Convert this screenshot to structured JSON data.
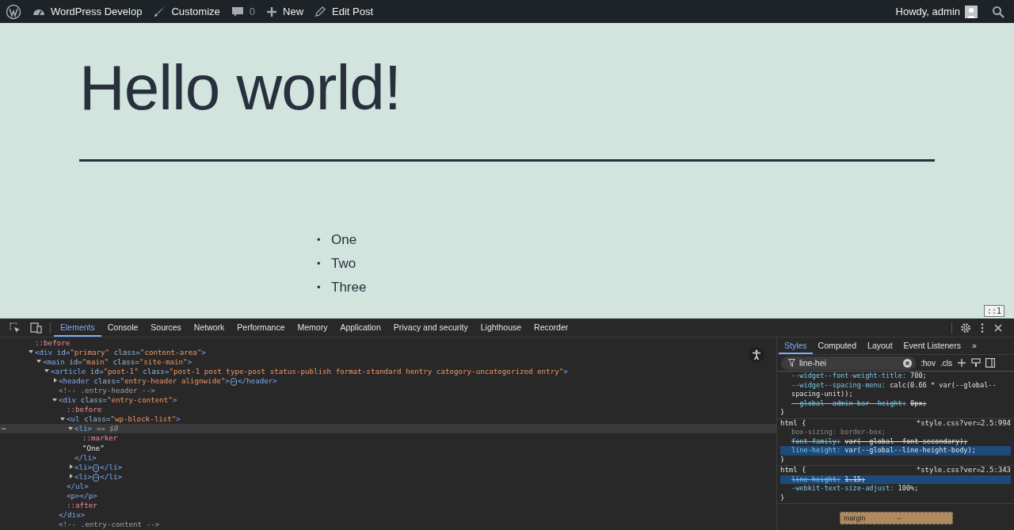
{
  "admin_bar": {
    "items": [
      {
        "kind": "logo"
      },
      {
        "kind": "site",
        "label": "WordPress Develop"
      },
      {
        "kind": "brush",
        "label": "Customize"
      },
      {
        "kind": "comment",
        "label": "0"
      },
      {
        "kind": "plus",
        "label": "New"
      },
      {
        "kind": "pencil",
        "label": "Edit Post"
      }
    ],
    "greeting": "Howdy, admin"
  },
  "page": {
    "title": "Hello world!",
    "list": [
      {
        "bullet": "•",
        "text": "One"
      },
      {
        "bullet": "•",
        "text": "Two"
      },
      {
        "bullet": "•",
        "text": "Three"
      }
    ],
    "badge": "::1"
  },
  "devtools": {
    "tabs": [
      {
        "label": "Elements",
        "selected": true
      },
      {
        "label": "Console",
        "selected": false
      },
      {
        "label": "Sources",
        "selected": false
      },
      {
        "label": "Network",
        "selected": false
      },
      {
        "label": "Performance",
        "selected": false
      },
      {
        "label": "Memory",
        "selected": false
      },
      {
        "label": "Application",
        "selected": false
      },
      {
        "label": "Privacy and security",
        "selected": false
      },
      {
        "label": "Lighthouse",
        "selected": false
      },
      {
        "label": "Recorder",
        "selected": false
      }
    ],
    "tree": [
      {
        "parts": [
          {
            "kind": "pseudo",
            "text": "::before"
          }
        ]
      },
      {
        "expanded": true,
        "parts": [
          {
            "kind": "tag",
            "text": "<div"
          },
          {
            "kind": "attr",
            "text": " id"
          },
          {
            "kind": "tag",
            "text": "="
          },
          {
            "kind": "value",
            "text": "\"primary\""
          },
          {
            "kind": "attr",
            "text": " class"
          },
          {
            "kind": "tag",
            "text": "="
          },
          {
            "kind": "value",
            "text": "\"content-area\""
          },
          {
            "kind": "tag",
            "text": ">"
          }
        ],
        "children": [
          {
            "expanded": true,
            "parts": [
              {
                "kind": "tag",
                "text": "<main"
              },
              {
                "kind": "attr",
                "text": " id"
              },
              {
                "kind": "tag",
                "text": "="
              },
              {
                "kind": "value",
                "text": "\"main\""
              },
              {
                "kind": "attr",
                "text": " class"
              },
              {
                "kind": "tag",
                "text": "="
              },
              {
                "kind": "value",
                "text": "\"site-main\""
              },
              {
                "kind": "tag",
                "text": ">"
              }
            ],
            "children": [
              {
                "expanded": true,
                "parts": [
                  {
                    "kind": "tag",
                    "text": "<article"
                  },
                  {
                    "kind": "attr",
                    "text": " id"
                  },
                  {
                    "kind": "tag",
                    "text": "="
                  },
                  {
                    "kind": "value",
                    "text": "\"post-1\""
                  },
                  {
                    "kind": "attr",
                    "text": " class"
                  },
                  {
                    "kind": "tag",
                    "text": "="
                  },
                  {
                    "kind": "value",
                    "text": "\"post-1 post type-post status-publish format-standard hentry category-uncategorized entry\""
                  },
                  {
                    "kind": "tag",
                    "text": ">"
                  }
                ],
                "children": [
                  {
                    "expanded": false,
                    "parts": [
                      {
                        "kind": "tag",
                        "text": "<header"
                      },
                      {
                        "kind": "attr",
                        "text": " class"
                      },
                      {
                        "kind": "tag",
                        "text": "="
                      },
                      {
                        "kind": "value",
                        "text": "\"entry-header alignwide\""
                      },
                      {
                        "kind": "tag",
                        "text": ">"
                      },
                      {
                        "kind": "ellipsis",
                        "text": "⋯"
                      },
                      {
                        "kind": "tag",
                        "text": "</header>"
                      }
                    ]
                  },
                  {
                    "parts": [
                      {
                        "kind": "comment",
                        "text": "<!-- .entry-header -->"
                      }
                    ]
                  },
                  {
                    "expanded": true,
                    "parts": [
                      {
                        "kind": "tag",
                        "text": "<div"
                      },
                      {
                        "kind": "attr",
                        "text": " class"
                      },
                      {
                        "kind": "tag",
                        "text": "="
                      },
                      {
                        "kind": "value",
                        "text": "\"entry-content\""
                      },
                      {
                        "kind": "tag",
                        "text": ">"
                      }
                    ],
                    "closing": "</div>",
                    "children": [
                      {
                        "parts": [
                          {
                            "kind": "pseudo",
                            "text": "::before"
                          }
                        ]
                      },
                      {
                        "expanded": true,
                        "parts": [
                          {
                            "kind": "tag",
                            "text": "<ul"
                          },
                          {
                            "kind": "attr",
                            "text": " class"
                          },
                          {
                            "kind": "tag",
                            "text": "="
                          },
                          {
                            "kind": "value",
                            "text": "\"wp-block-list\""
                          },
                          {
                            "kind": "tag",
                            "text": ">"
                          }
                        ],
                        "closing": "</ul>",
                        "children": [
                          {
                            "expanded": true,
                            "selected": true,
                            "gutter": "⋯",
                            "parts": [
                              {
                                "kind": "tag",
                                "text": "<li>"
                              },
                              {
                                "kind": "ref",
                                "text": " == $0"
                              }
                            ],
                            "closing": "</li>",
                            "children": [
                              {
                                "parts": [
                                  {
                                    "kind": "pseudo",
                                    "text": "::marker"
                                  }
                                ]
                              },
                              {
                                "parts": [
                                  {
                                    "kind": "text",
                                    "text": "\"One\""
                                  }
                                ]
                              }
                            ]
                          },
                          {
                            "expanded": false,
                            "selected": false,
                            "parts": [
                              {
                                "kind": "tag",
                                "text": "<li>"
                              },
                              {
                                "kind": "ellipsis",
                                "text": "⋯"
                              },
                              {
                                "kind": "tag",
                                "text": "</li>"
                              }
                            ]
                          },
                          {
                            "expanded": false,
                            "selected": false,
                            "parts": [
                              {
                                "kind": "tag",
                                "text": "<li>"
                              },
                              {
                                "kind": "ellipsis",
                                "text": "⋯"
                              },
                              {
                                "kind": "tag",
                                "text": "</li>"
                              }
                            ]
                          }
                        ]
                      },
                      {
                        "parts": [
                          {
                            "kind": "tag",
                            "text": "<p></p>"
                          }
                        ]
                      },
                      {
                        "parts": [
                          {
                            "kind": "pseudo",
                            "text": "::after"
                          }
                        ]
                      }
                    ]
                  },
                  {
                    "parts": [
                      {
                        "kind": "comment",
                        "text": "<!-- .entry-content -->"
                      }
                    ]
                  }
                ]
              }
            ]
          }
        ]
      }
    ],
    "side_tabs": [
      {
        "label": "Styles",
        "selected": true
      },
      {
        "label": "Computed",
        "selected": false
      },
      {
        "label": "Layout",
        "selected": false
      },
      {
        "label": "Event Listeners",
        "selected": false
      }
    ],
    "side_more": "»",
    "filter": {
      "value": "line-hei"
    },
    "hov": ":hov",
    "cls": ".cls",
    "rules": [
      {
        "declarations": [
          {
            "name": "--widget--font-weight-title:",
            "value": "700;",
            "struck": false,
            "highlighted": false,
            "inactive": false
          },
          {
            "name": "--widget--spacing-menu:",
            "value": "calc(0.66 * var(--global--spacing-unit));",
            "struck": false,
            "highlighted": false,
            "inactive": false
          },
          {
            "name": "--global--admin-bar--height:",
            "value": "0px;",
            "struck": true,
            "highlighted": false,
            "inactive": false
          }
        ]
      },
      {
        "selector": "html {",
        "source": "*style.css?ver=2.5:994",
        "declarations": [
          {
            "name": "box-sizing:",
            "value": "border-box;",
            "struck": false,
            "highlighted": false,
            "inactive": true
          },
          {
            "name": "font-family:",
            "value": "var(--global--font-secondary);",
            "struck": true,
            "highlighted": false,
            "inactive": false
          },
          {
            "name": "line-height:",
            "value": "var(--global--line-height-body);",
            "struck": false,
            "highlighted": true,
            "inactive": false
          }
        ]
      },
      {
        "selector": "html {",
        "source": "*style.css?ver=2.5:343",
        "declarations": [
          {
            "name": "line-height:",
            "value": "1.15;",
            "struck": true,
            "highlighted": true,
            "inactive": false
          },
          {
            "name": "-webkit-text-size-adjust:",
            "value": "100%;",
            "struck": false,
            "highlighted": false,
            "inactive": false
          }
        ]
      }
    ],
    "rule_close": "}",
    "box_model": {
      "label": "margin",
      "value": "–"
    }
  }
}
